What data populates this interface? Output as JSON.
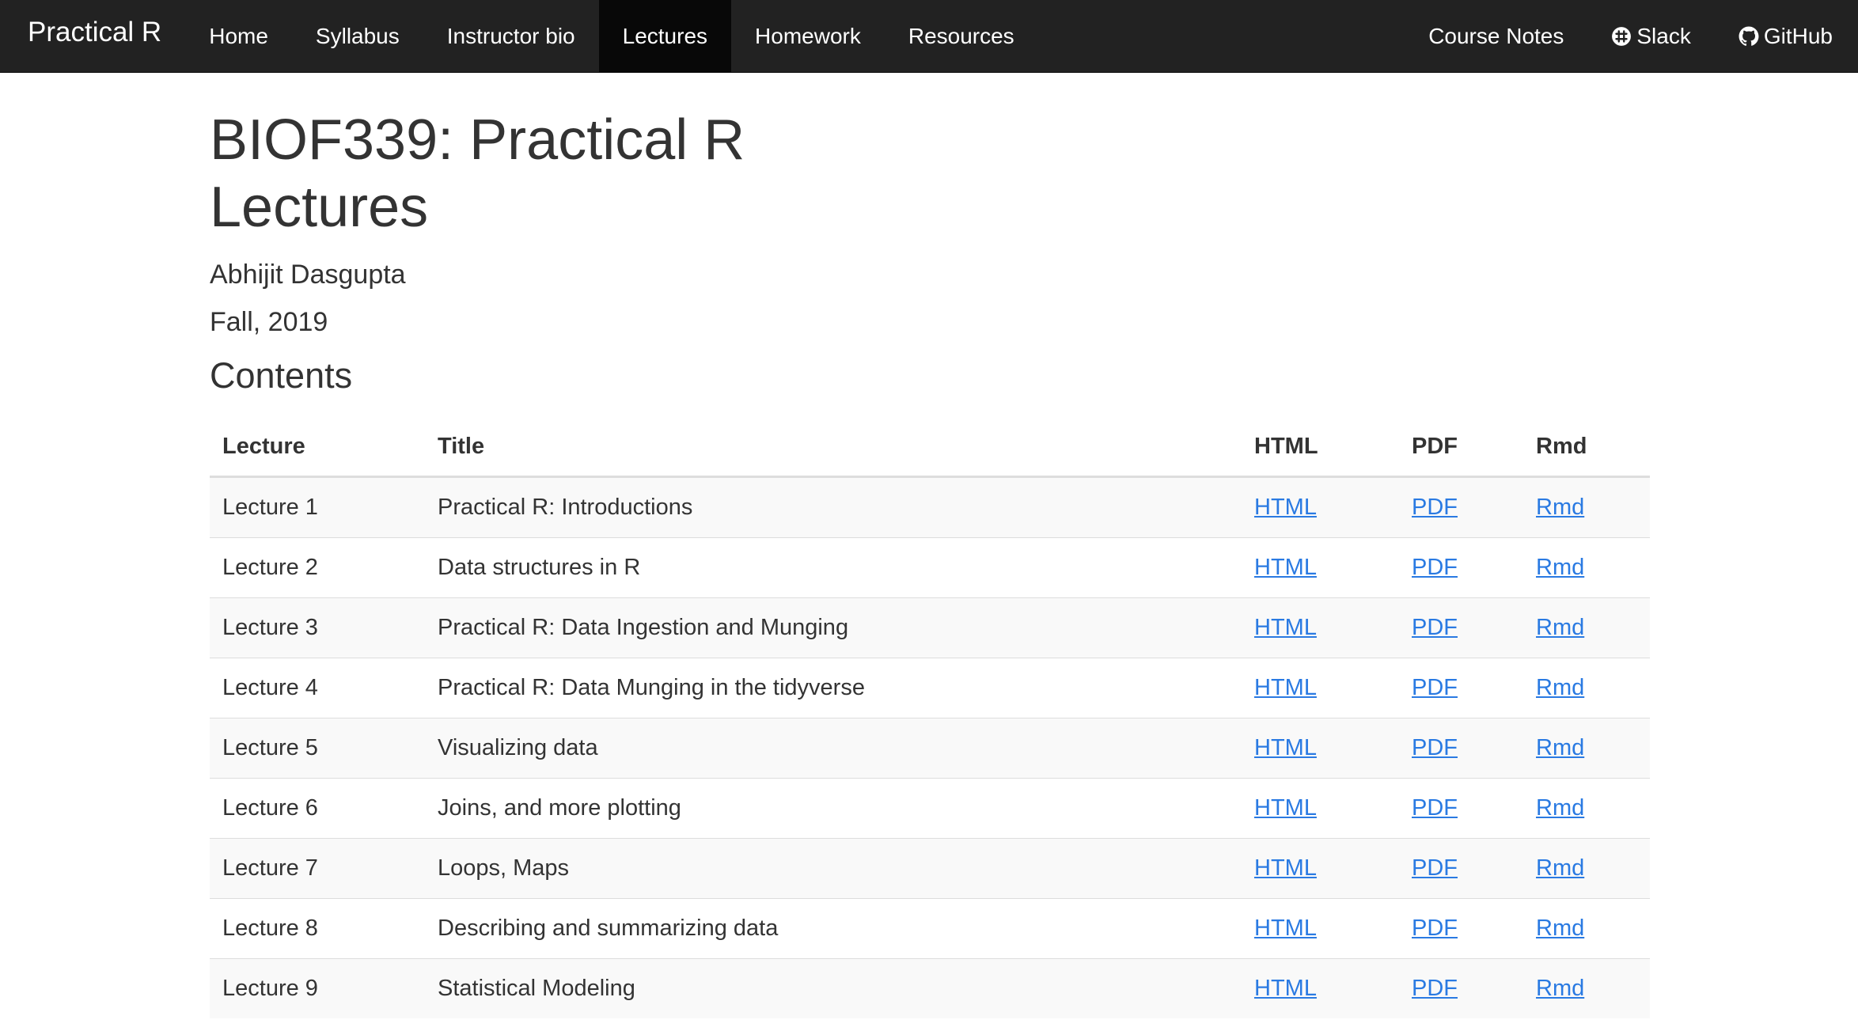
{
  "navbar": {
    "brand": "Practical R",
    "left_items": [
      "Home",
      "Syllabus",
      "Instructor bio",
      "Lectures",
      "Homework",
      "Resources"
    ],
    "active_item": "Lectures",
    "right_items": {
      "course_notes": "Course Notes",
      "slack": "Slack",
      "github": "GitHub"
    }
  },
  "page": {
    "title": "BIOF339: Practical R Lectures",
    "author": "Abhijit Dasgupta",
    "date": "Fall, 2019",
    "contents_heading": "Contents"
  },
  "table": {
    "headers": [
      "Lecture",
      "Title",
      "HTML",
      "PDF",
      "Rmd"
    ],
    "rows": [
      {
        "lecture": "Lecture 1",
        "title": "Practical R: Introductions",
        "html": "HTML",
        "pdf": "PDF",
        "rmd": "Rmd"
      },
      {
        "lecture": "Lecture 2",
        "title": "Data structures in R",
        "html": "HTML",
        "pdf": "PDF",
        "rmd": "Rmd"
      },
      {
        "lecture": "Lecture 3",
        "title": "Practical R: Data Ingestion and Munging",
        "html": "HTML",
        "pdf": "PDF",
        "rmd": "Rmd"
      },
      {
        "lecture": "Lecture 4",
        "title": "Practical R: Data Munging in the tidyverse",
        "html": "HTML",
        "pdf": "PDF",
        "rmd": "Rmd"
      },
      {
        "lecture": "Lecture 5",
        "title": "Visualizing data",
        "html": "HTML",
        "pdf": "PDF",
        "rmd": "Rmd"
      },
      {
        "lecture": "Lecture 6",
        "title": "Joins, and more plotting",
        "html": "HTML",
        "pdf": "PDF",
        "rmd": "Rmd"
      },
      {
        "lecture": "Lecture 7",
        "title": "Loops, Maps",
        "html": "HTML",
        "pdf": "PDF",
        "rmd": "Rmd"
      },
      {
        "lecture": "Lecture 8",
        "title": "Describing and summarizing data",
        "html": "HTML",
        "pdf": "PDF",
        "rmd": "Rmd"
      },
      {
        "lecture": "Lecture 9",
        "title": "Statistical Modeling",
        "html": "HTML",
        "pdf": "PDF",
        "rmd": "Rmd"
      }
    ]
  },
  "colors": {
    "navbar_bg": "#222222",
    "navbar_active_bg": "#080808",
    "link": "#2a7ae2",
    "text": "#333333",
    "row_stripe": "#f9f9f9"
  },
  "icons": {
    "slack": "slack-icon",
    "github": "github-icon"
  }
}
